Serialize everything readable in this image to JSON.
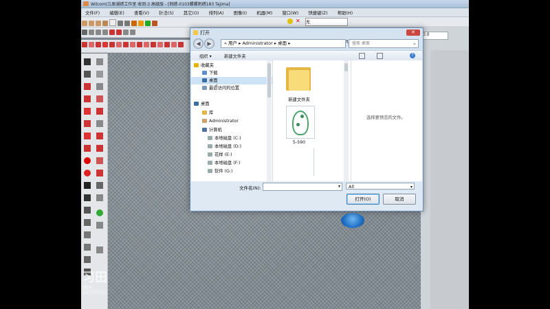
{
  "app": {
    "title": "Wilcom(三原湖绣工作室 收到:3 高级版 - [刺绣-0103螺螺刺绣183       Tajima]",
    "menus": [
      "文件(F)",
      "编辑(E)",
      "查看(V)",
      "针法(S)",
      "其它(O)",
      "排列(A)",
      "图像(I)",
      "机器(M)",
      "窗口(W)",
      "快捷键(Z)",
      "帮助(H)"
    ],
    "toolbar_values": {
      "combo_none": "无",
      "spin_value": "0.0"
    }
  },
  "dialog": {
    "title": "打开",
    "address": "« 用户 ▸ Administrator ▸ 桌面 ▸",
    "search_placeholder": "搜索 桌面",
    "organize_label": "组织 ▾",
    "new_folder_label": "新建文件夹",
    "tree": [
      {
        "label": "收藏夹",
        "icon": "star-icon",
        "indent": 0,
        "selected": false
      },
      {
        "label": "下载",
        "icon": "download-icon",
        "indent": 1,
        "selected": false
      },
      {
        "label": "桌面",
        "icon": "desktop-icon",
        "indent": 1,
        "selected": true
      },
      {
        "label": "最近访问的位置",
        "icon": "recent-icon",
        "indent": 1,
        "selected": false
      },
      {
        "label": "桌面",
        "icon": "desktop-icon",
        "indent": 0,
        "selected": false
      },
      {
        "label": "库",
        "icon": "library-icon",
        "indent": 1,
        "selected": false
      },
      {
        "label": "Administrator",
        "icon": "user-icon",
        "indent": 1,
        "selected": false
      },
      {
        "label": "计算机",
        "icon": "computer-icon",
        "indent": 1,
        "selected": false
      },
      {
        "label": "本地磁盘 (C:)",
        "icon": "drive-icon",
        "indent": 2,
        "selected": false
      },
      {
        "label": "本地磁盘 (D:)",
        "icon": "drive-icon",
        "indent": 2,
        "selected": false
      },
      {
        "label": "花样 (E:)",
        "icon": "drive-icon",
        "indent": 2,
        "selected": false
      },
      {
        "label": "本地磁盘 (F:)",
        "icon": "drive-icon",
        "indent": 2,
        "selected": false
      },
      {
        "label": "软件 (G:)",
        "icon": "drive-icon",
        "indent": 2,
        "selected": false
      }
    ],
    "files": [
      {
        "name": "新建文件夹",
        "icon": "folder-icon"
      },
      {
        "name": "5-590",
        "icon": "embroidery-file-icon"
      }
    ],
    "preview_text": "选择要预览的文件。",
    "filename_label": "文件名(N):",
    "filename_value": "",
    "filetype_value": "All",
    "open_button": "打开(O)",
    "cancel_button": "取消"
  },
  "watermark": {
    "logo_text": "习田",
    "sub_text": "绣吧",
    "code": "20150711"
  },
  "colors": {
    "dialog_bg": "#d5e2f0",
    "close_red": "#c9473d",
    "folder_yellow": "#e5b644",
    "shell_blue": "#1f6fc5"
  }
}
